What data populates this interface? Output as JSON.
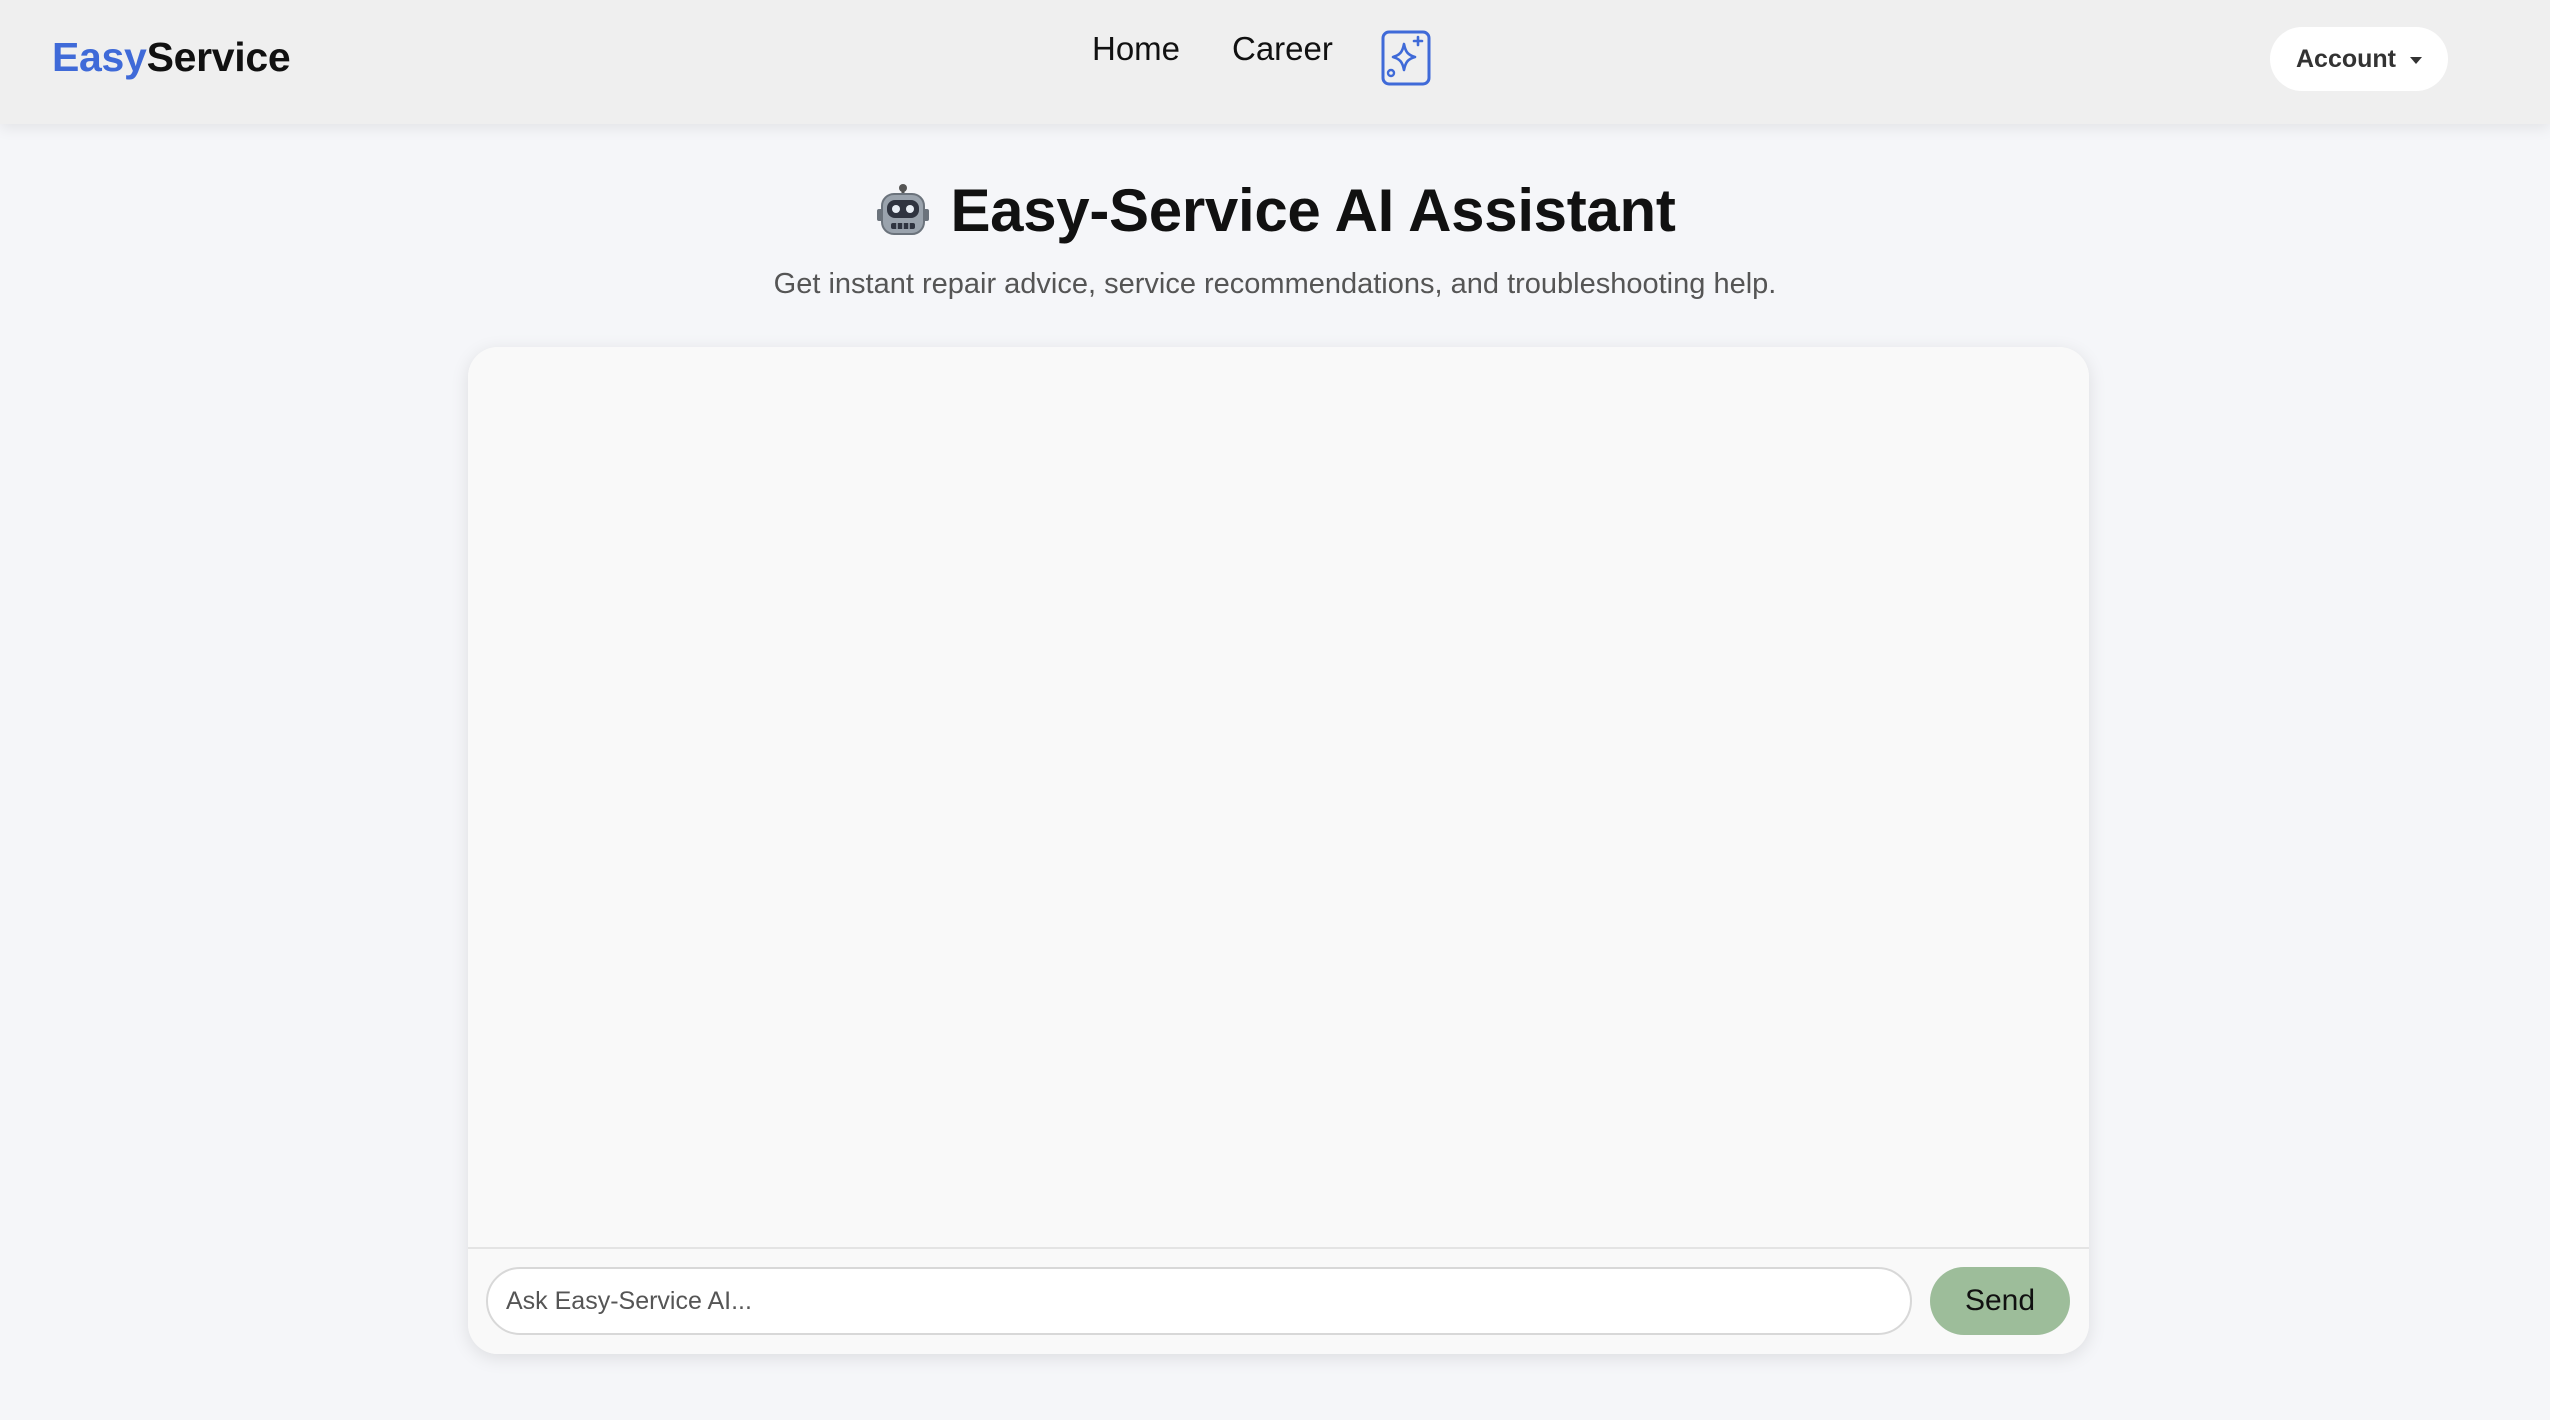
{
  "brand": {
    "easy": "Easy",
    "service": "Service"
  },
  "nav": {
    "home": "Home",
    "career": "Career",
    "ai_icon": "sparkle-icon"
  },
  "account": {
    "label": "Account",
    "icon": "caret-down-icon"
  },
  "page": {
    "title_icon": "robot-icon",
    "title": "Easy-Service AI Assistant",
    "subtitle": "Get instant repair advice, service recommendations, and troubleshooting help."
  },
  "chat": {
    "input_placeholder": "Ask Easy-Service AI...",
    "input_value": "",
    "send_label": "Send"
  },
  "colors": {
    "brand_accent": "#3f6ad8",
    "send_button": "#9dbd9a",
    "navbar_bg": "#efefef",
    "page_bg": "#f5f6f9"
  }
}
